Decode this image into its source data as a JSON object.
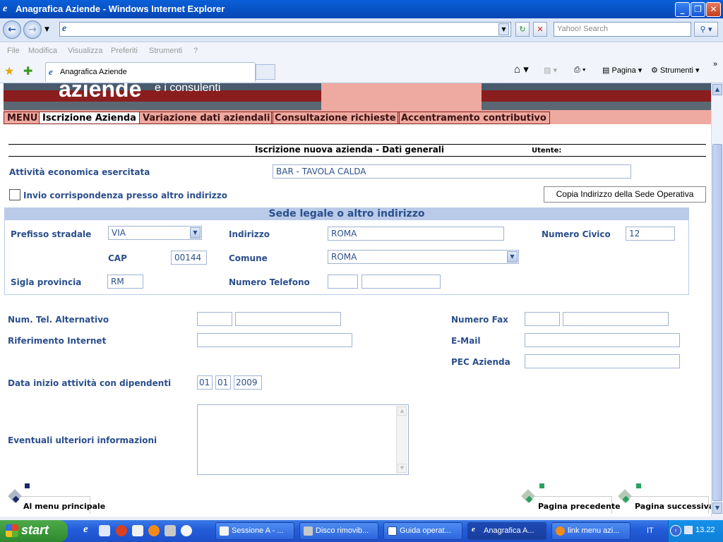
{
  "window": {
    "title": "Anagrafica Aziende - Windows Internet Explorer"
  },
  "browser": {
    "search_placeholder": "Yahoo! Search",
    "menu": [
      "File",
      "Modifica",
      "Visualizza",
      "Preferiti",
      "Strumenti",
      "?"
    ],
    "tab_title": "Anagrafica Aziende",
    "tools": {
      "page": "Pagina",
      "tools": "Strumenti"
    }
  },
  "site": {
    "brand": "aziende",
    "brand_sub": "e i consulenti",
    "nav": [
      "MENU",
      "Iscrizione Azienda",
      "Variazione dati aziendali",
      "Consultazione richieste",
      "Accentramento contributivo"
    ],
    "selected_nav": "Iscrizione Azienda"
  },
  "form": {
    "heading": "Iscrizione nuova azienda - Dati generali",
    "user_label": "Utente:",
    "attivita_label": "Attività economica esercitata",
    "attivita_value": "BAR - TAVOLA CALDA",
    "invio_label": "Invio corrispondenza presso altro indirizzo",
    "invio_checked": false,
    "copy_button": "Copia Indirizzo della Sede Operativa",
    "sede_legend": "Sede legale o altro indirizzo",
    "prefisso_label": "Prefisso stradale",
    "prefisso_value": "VIA",
    "indirizzo_label": "Indirizzo",
    "indirizzo_value": "ROMA",
    "civico_label": "Numero Civico",
    "civico_value": "12",
    "cap_label": "CAP",
    "cap_value": "00144",
    "comune_label": "Comune",
    "comune_value": "ROMA",
    "provincia_label": "Sigla provincia",
    "provincia_value": "RM",
    "telefono_label": "Numero Telefono",
    "tel_alt_label": "Num. Tel. Alternativo",
    "fax_label": "Numero Fax",
    "internet_label": "Riferimento Internet",
    "email_label": "E-Mail",
    "pec_label": "PEC Azienda",
    "data_label": "Data inizio attività con dipendenti",
    "data_day": "01",
    "data_month": "01",
    "data_year": "2009",
    "info_label": "Eventuali ulteriori informazioni",
    "info_value": "",
    "btn_menu": "Al menu principale",
    "btn_prev": "Pagina precedente",
    "btn_next": "Pagina successiva"
  },
  "taskbar": {
    "start": "start",
    "tasks": [
      "Sessione A - ...",
      "Disco rimovib...",
      "Guida operat...",
      "Anagrafica A...",
      "link menu azi..."
    ],
    "active_task": "Anagrafica A...",
    "lang": "IT",
    "clock": "13.22"
  },
  "colors": {
    "label_blue": "#2b4f8c",
    "legend_bg": "#b9cbe8",
    "nav_pink": "#eeaaa0",
    "banner_red": "#8a1d1d"
  }
}
